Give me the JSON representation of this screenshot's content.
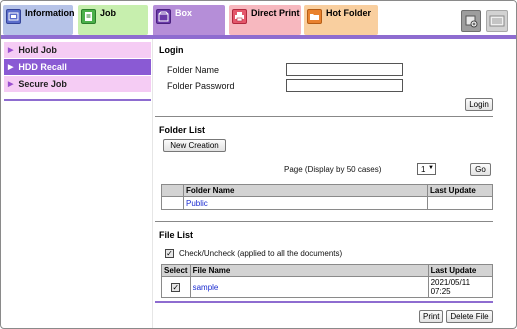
{
  "tabs": {
    "information": {
      "label": "Information",
      "icon": "information-icon"
    },
    "job": {
      "label": "Job",
      "icon": "job-icon"
    },
    "box": {
      "label": "Box",
      "icon": "box-icon",
      "active": true
    },
    "direct_print": {
      "label": "Direct Print",
      "icon": "direct-print-icon"
    },
    "hot_folder": {
      "label": "Hot Folder",
      "icon": "hot-folder-icon"
    },
    "extra_buttons": [
      {
        "icon": "device-icon"
      },
      {
        "icon": "keyboard-icon"
      }
    ]
  },
  "sidebar": {
    "items": [
      {
        "label": "Hold Job",
        "active": false
      },
      {
        "label": "HDD Recall",
        "active": true
      },
      {
        "label": "Secure Job",
        "active": false
      }
    ]
  },
  "login": {
    "title": "Login",
    "folder_name_label": "Folder Name",
    "folder_name_value": "",
    "folder_password_label": "Folder Password",
    "folder_password_value": "",
    "login_button": "Login"
  },
  "folder_list": {
    "title": "Folder List",
    "new_creation_button": "New Creation",
    "page_label": "Page (Display by 50 cases)",
    "page_value": "1",
    "go_button": "Go",
    "columns": [
      "",
      "Folder Name",
      "Last Update"
    ],
    "rows": [
      {
        "name": "Public",
        "last_update": ""
      }
    ]
  },
  "file_list": {
    "title": "File List",
    "check_all_label": "Check/Uncheck (applied to all the documents)",
    "check_all_checked": true,
    "columns": [
      "Select",
      "File Name",
      "Last Update"
    ],
    "rows": [
      {
        "selected": true,
        "name": "sample",
        "last_update": "2021/05/11 07:25"
      }
    ],
    "print_button": "Print",
    "delete_button": "Delete File"
  },
  "colors": {
    "accent": "#8e6cd0",
    "sidebar_active": "#8a5ad4",
    "sidebar_inactive": "#f5ccf4",
    "link": "#1a2bd0"
  }
}
